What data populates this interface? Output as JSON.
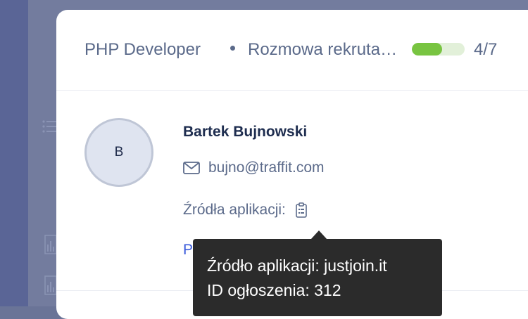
{
  "header": {
    "job_title": "PHP Developer",
    "stage_name": "Rozmowa rekrutacyjna",
    "stage_progress": 0.57,
    "stage_count": "4/7"
  },
  "candidate": {
    "avatar_initial": "B",
    "name": "Bartek Bujnowski",
    "email": "bujno@traffit.com",
    "sources_label": "Źródła aplikacji:",
    "link_text_visible": "P"
  },
  "tooltip": {
    "line1": "Źródło aplikacji: justjoin.it",
    "line2": "ID ogłoszenia: 312"
  },
  "icons": {
    "mail": "envelope-icon",
    "sources": "clipboard-icon",
    "bg_list": "list-icon",
    "bg_chart": "bar-chart-icon"
  },
  "colors": {
    "progress_fill": "#78c441",
    "progress_track": "#e2f0d9",
    "tooltip_bg": "#2b2b2b",
    "link": "#3b5bdb"
  }
}
